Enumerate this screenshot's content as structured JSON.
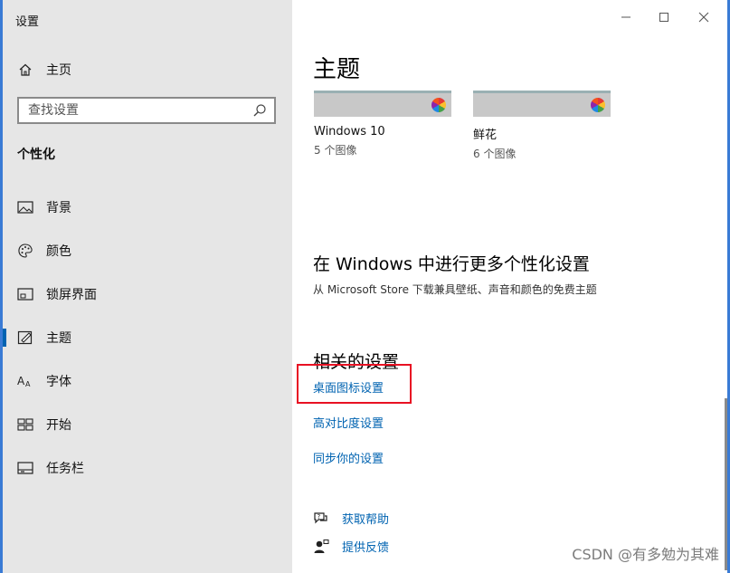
{
  "window": {
    "title": "设置"
  },
  "sidebar": {
    "home_label": "主页",
    "search_placeholder": "查找设置",
    "section_title": "个性化",
    "items": [
      {
        "label": "背景",
        "icon": "picture-icon"
      },
      {
        "label": "颜色",
        "icon": "palette-icon"
      },
      {
        "label": "锁屏界面",
        "icon": "lock-screen-icon"
      },
      {
        "label": "主题",
        "icon": "theme-icon",
        "active": true
      },
      {
        "label": "字体",
        "icon": "font-icon"
      },
      {
        "label": "开始",
        "icon": "start-icon"
      },
      {
        "label": "任务栏",
        "icon": "taskbar-icon"
      }
    ]
  },
  "main": {
    "title": "主题",
    "themes": [
      {
        "name": "Windows 10",
        "count": "5 个图像"
      },
      {
        "name": "鲜花",
        "count": "6 个图像"
      }
    ],
    "more": {
      "heading": "在 Windows 中进行更多个性化设置",
      "subtext": "从 Microsoft Store 下载兼具壁纸、声音和颜色的免费主题"
    },
    "related": {
      "heading": "相关的设置",
      "links": [
        "桌面图标设置",
        "高对比度设置",
        "同步你的设置"
      ]
    },
    "help": {
      "get_help": "获取帮助",
      "feedback": "提供反馈"
    }
  },
  "watermark": "CSDN @有多勉为其难",
  "colors": {
    "accent": "#0063b1",
    "sidebar_bg": "#e6e6e6",
    "highlight": "#e81123"
  }
}
